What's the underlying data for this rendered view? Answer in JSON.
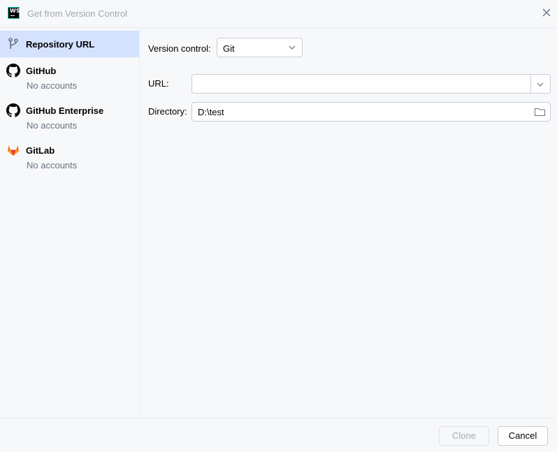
{
  "window": {
    "title": "Get from Version Control"
  },
  "sidebar": {
    "items": [
      {
        "label": "Repository URL",
        "sub": ""
      },
      {
        "label": "GitHub",
        "sub": "No accounts"
      },
      {
        "label": "GitHub Enterprise",
        "sub": "No accounts"
      },
      {
        "label": "GitLab",
        "sub": "No accounts"
      }
    ]
  },
  "form": {
    "version_control_label": "Version control:",
    "version_control_value": "Git",
    "url_label": "URL:",
    "url_value": "",
    "directory_label": "Directory:",
    "directory_value": "D:\\test"
  },
  "footer": {
    "clone_label": "Clone",
    "cancel_label": "Cancel"
  },
  "colors": {
    "selected_bg": "#d4e2ff",
    "gitlab_orange": "#e24329",
    "logo_accent": "#21d7c5"
  }
}
